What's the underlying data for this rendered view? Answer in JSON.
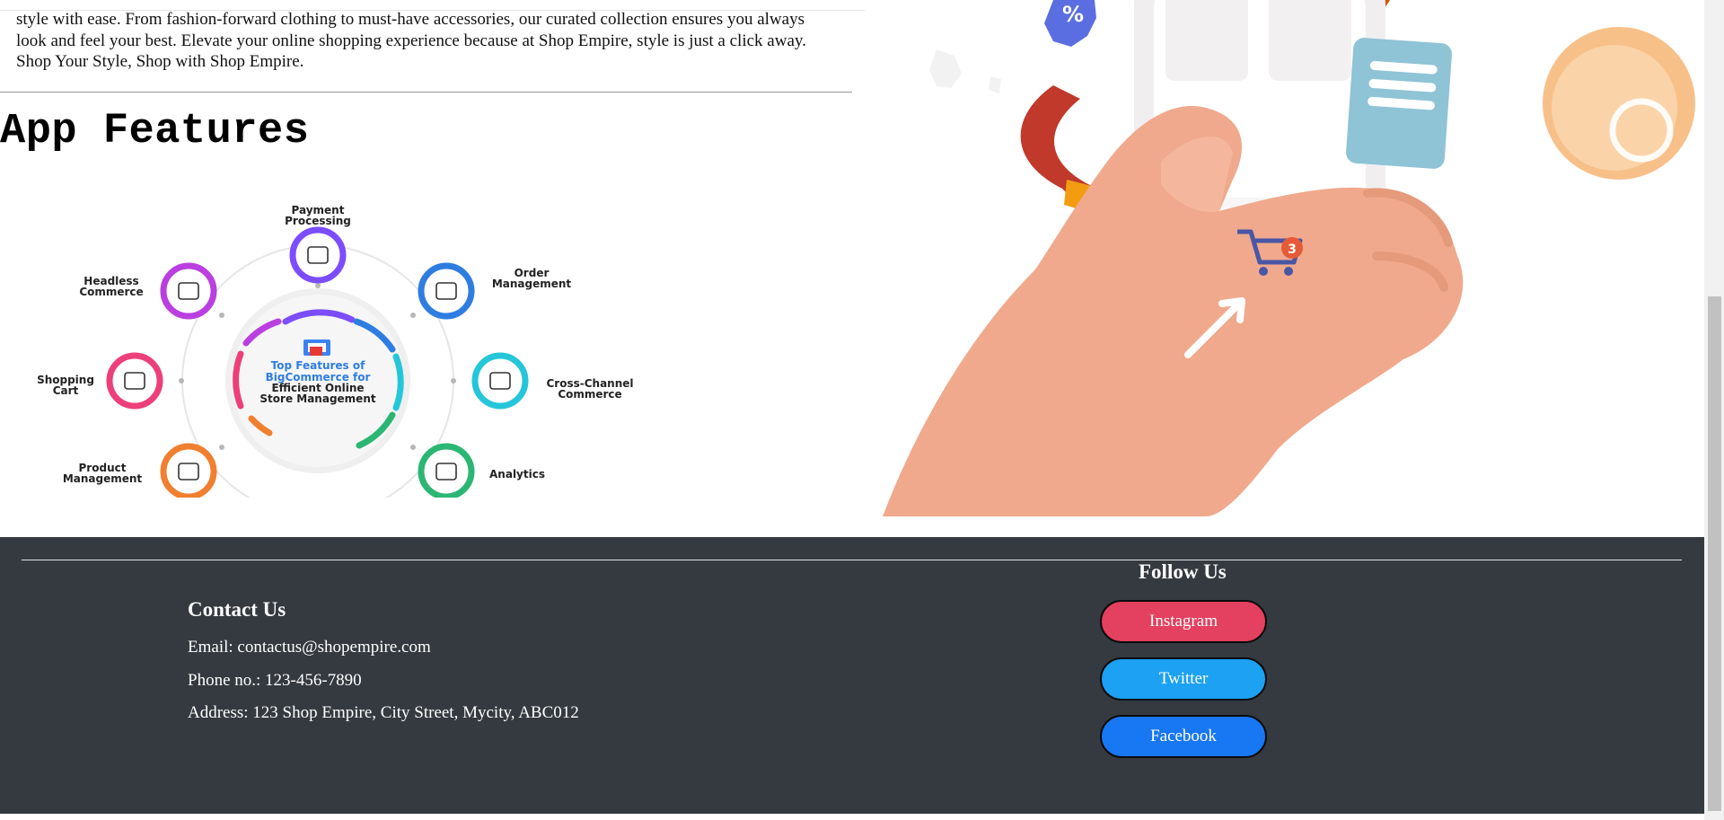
{
  "intro": {
    "text": "style with ease. From fashion-forward clothing to must-have accessories, our curated collection ensures you always look and feel your best. Elevate your online shopping experience because at Shop Empire, style is just a click away. Shop Your Style, Shop with Shop Empire."
  },
  "features": {
    "heading": "App Features",
    "center_lines": [
      "Top Features of",
      "BigCommerce for",
      "Efficient Online",
      "Store Management"
    ],
    "items": [
      {
        "line1": "Payment",
        "line2": "Processing",
        "color": "#7c4dff"
      },
      {
        "line1": "Order",
        "line2": "Management",
        "color": "#2f7de1"
      },
      {
        "line1": "Cross-Channel",
        "line2": "Commerce",
        "color": "#26c6da"
      },
      {
        "line1": "Analytics",
        "line2": "",
        "color": "#2bb673"
      },
      {
        "line1": "Product",
        "line2": "Management",
        "color": "#f07f2f"
      },
      {
        "line1": "Shopping",
        "line2": "Cart",
        "color": "#ec407a"
      },
      {
        "line1": "Headless",
        "line2": "Commerce",
        "color": "#ba3fe0"
      }
    ]
  },
  "hero": {
    "badge_text": "%",
    "cart_count": "3"
  },
  "footer": {
    "contact_heading": "Contact Us",
    "email": "Email: contactus@shopempire.com",
    "phone": "Phone no.: 123-456-7890",
    "address": "Address: 123 Shop Empire, City Street, Mycity, ABC012",
    "follow_heading": "Follow Us",
    "social": [
      {
        "label": "Instagram",
        "color": "#e4405f"
      },
      {
        "label": "Twitter",
        "color": "#1da1f2"
      },
      {
        "label": "Facebook",
        "color": "#1877f2"
      }
    ]
  }
}
